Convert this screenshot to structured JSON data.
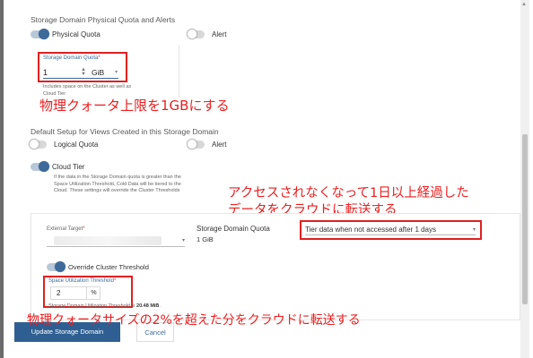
{
  "quota_section": {
    "title": "Storage Domain Physical Quota and Alerts",
    "physical_quota_label": "Physical Quota",
    "alert_label": "Alert",
    "quota_field_label": "Storage Domain Quota",
    "quota_required_mark": "*",
    "quota_value": "1",
    "quota_unit": "GiB",
    "quota_hint": "Includes space on the Cluster as well as Cloud Tier"
  },
  "default_section": {
    "title": "Default Setup for Views Created in this Storage Domain",
    "logical_quota_label": "Logical Quota",
    "alert_label": "Alert",
    "cloud_tier_label": "Cloud Tier",
    "cloud_tier_hint": "If the data in the Storage Domain quota is greater than the Space Utilization Threshold, Cold Data will be tiered to the Cloud. These settings will override the Cluster Thresholds"
  },
  "tier_card": {
    "external_target_label": "External Target",
    "required_mark": "*",
    "external_target_value": "",
    "storage_domain_quota_label": "Storage Domain Quota",
    "storage_domain_quota_value": "1 GiB",
    "tier_select_value": "Tier data when not accessed after 1 days",
    "override_label": "Override Cluster Threshold",
    "threshold_label": "Space Utilization Threshold",
    "threshold_value": "2",
    "threshold_unit": "%",
    "threshold_note_prefix": "Storage Domain Utilization Threshold is ",
    "threshold_note_value": "20.48 MiB",
    "threshold_note_suffix": "."
  },
  "footer": {
    "update_button": "Update Storage Domain",
    "cancel_button": "Cancel"
  },
  "annotations": {
    "quota_note": "物理クォータ上限を1GBにする",
    "tier_note_line1": "アクセスされなくなって1日以上経過した",
    "tier_note_line2": "データをクラウドに転送する",
    "threshold_note": "物理クォータサイズの2%を超えた分をクラウドに転送する"
  },
  "colors": {
    "accent": "#3d6a9a",
    "annotation": "#e02020",
    "primary_button": "#2f5f92"
  }
}
